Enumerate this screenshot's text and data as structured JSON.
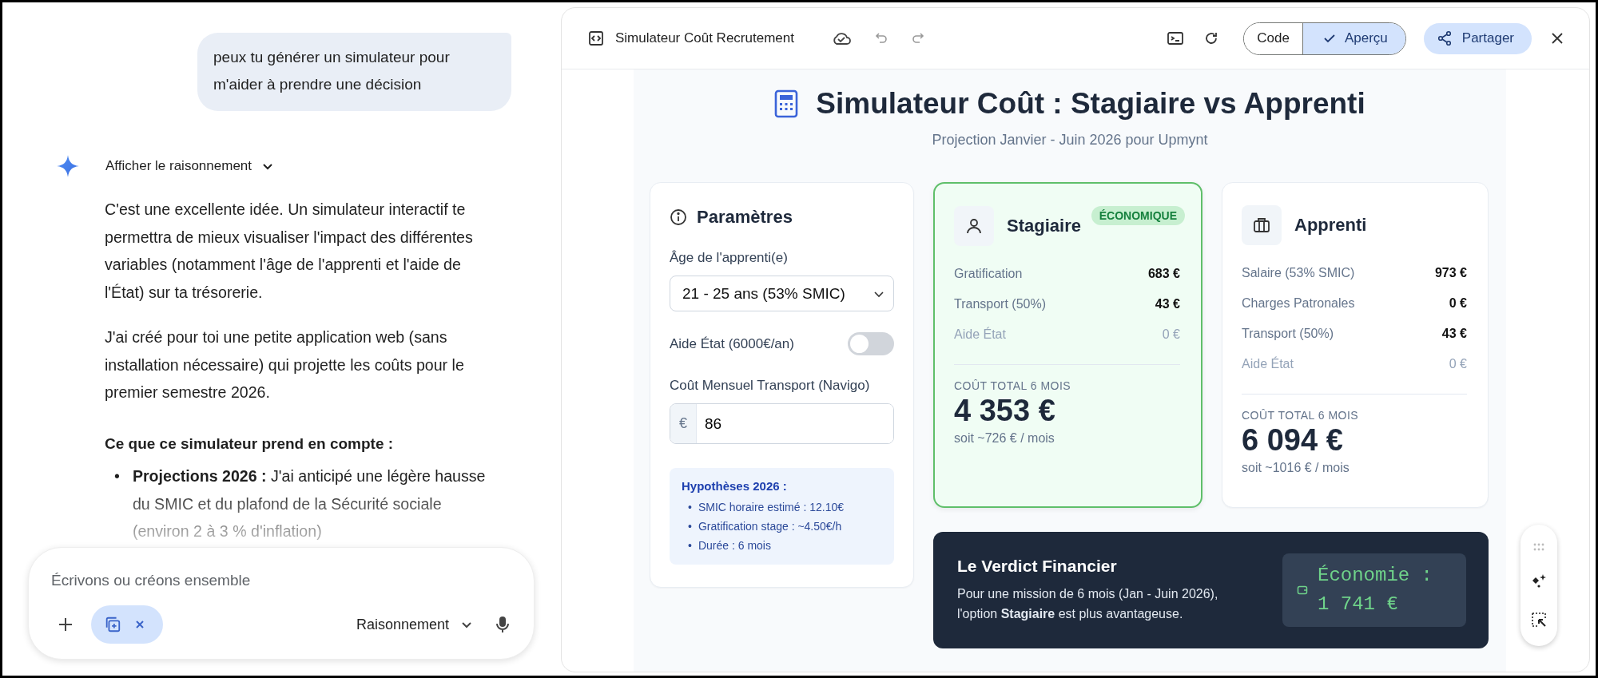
{
  "chat": {
    "user_message": "peux tu générer un simulateur pour m'aider à prendre une décision",
    "reasoning_toggle": {
      "label": "Afficher le raisonnement",
      "expanded": false
    },
    "paragraphs": [
      "C'est une excellente idée. Un simulateur interactif te permettra de mieux visualiser l'impact des différentes variables (notamment l'âge de l'apprenti et l'aide de l'État) sur ta trésorerie.",
      "J'ai créé pour toi une petite application web (sans installation nécessaire) qui projette les coûts pour le premier semestre 2026."
    ],
    "heading": "Ce que ce simulateur prend en compte :",
    "bullet_marker": "•",
    "bullets": [
      "**Projections 2026 :** J'ai anticipé une légère hausse du SMIC et du plafond de la Sécurité sociale (environ 2 à 3 % d'inflation)"
    ]
  },
  "composer": {
    "placeholder": "Écrivons ou créons ensemble",
    "mode": "Raisonnement"
  },
  "canvas": {
    "title": "Simulateur Coût Recrutement",
    "view_toggle": [
      {
        "label": "Code",
        "selected": false
      },
      {
        "label": "Aperçu",
        "selected": true
      }
    ],
    "share_button": "Partager"
  },
  "app": {
    "title": "Simulateur Coût : Stagiaire vs Apprenti",
    "subtitle": "Projection Janvier - Juin 2026 pour Upmynt",
    "parameters": {
      "title": "Paramètres",
      "age_label": "Âge de l'apprenti(e)",
      "age_value": "21 - 25 ans (53% SMIC)",
      "aid": {
        "label": "Aide État (6000€/an)",
        "on": false
      },
      "transport_label": "Coût Mensuel Transport (Navigo)",
      "transport_prefix": "€",
      "transport_value": "86",
      "assumptions_title": "Hypothèses 2026 :",
      "bullet_marker": "•",
      "assumptions": [
        "SMIC horaire estimé : 12.10€",
        "Gratification stage : ~4.50€/h",
        "Durée : 6 mois"
      ]
    },
    "options": [
      {
        "kind": "intern",
        "name": "Stagiaire",
        "badge": "ÉCONOMIQUE",
        "highlighted": true,
        "rows": [
          {
            "label": "Gratification",
            "value": "683 €",
            "muted": false
          },
          {
            "label": "Transport (50%)",
            "value": "43 €",
            "muted": false
          },
          {
            "label": "Aide État",
            "value": "0 €",
            "muted": true
          }
        ],
        "total_label": "COÛT TOTAL 6 MOIS",
        "total": "4 353 €",
        "monthly": "soit ~726 € / mois"
      },
      {
        "kind": "apprentice",
        "name": "Apprenti",
        "highlighted": false,
        "rows": [
          {
            "label": "Salaire (53% SMIC)",
            "value": "973 €",
            "muted": false
          },
          {
            "label": "Charges Patronales",
            "value": "0 €",
            "muted": false
          },
          {
            "label": "Transport (50%)",
            "value": "43 €",
            "muted": false
          },
          {
            "label": "Aide État",
            "value": "0 €",
            "muted": true
          }
        ],
        "total_label": "COÛT TOTAL 6 MOIS",
        "total": "6 094 €",
        "monthly": "soit ~1016 € / mois"
      }
    ],
    "verdict": {
      "title": "Le Verdict Financier",
      "text": "Pour une mission de 6 mois (Jan - Juin 2026), l'option **Stagiaire** est plus avantageuse.",
      "savings": "Économie : 1 741 €"
    }
  }
}
